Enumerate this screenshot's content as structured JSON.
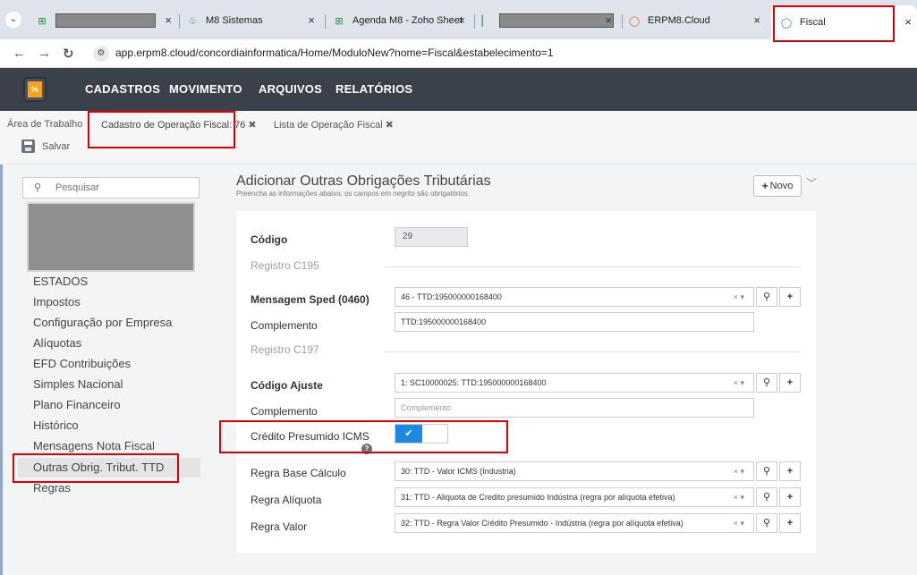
{
  "browser": {
    "tabs": [
      {
        "label": "",
        "redacted": true
      },
      {
        "label": "M8 Sistemas"
      },
      {
        "label": "Agenda M8 - Zoho Sheet"
      },
      {
        "label": "",
        "redacted": true
      },
      {
        "label": "ERPM8.Cloud"
      },
      {
        "label": "Fiscal",
        "active": true
      }
    ],
    "tab_close": "×",
    "url": "app.erpm8.cloud/concordiainformatica/Home/ModuloNew?nome=Fiscal&estabelecimento=1"
  },
  "menu": {
    "logo_text": "%",
    "items": [
      "CADASTROS",
      "MOVIMENTO",
      "ARQUIVOS",
      "RELATÓRIOS"
    ]
  },
  "breadcrumb": {
    "items": [
      "Área de Trabalho",
      "Cadastro de Operação Fiscal: 76",
      "Lista de Operação Fiscal"
    ],
    "close": "✖"
  },
  "toolbar": {
    "save_label": "Salvar"
  },
  "sidebar": {
    "search_placeholder": "Pesquisar",
    "items": [
      "ESTADOS",
      "Impostos",
      "Configuração por Empresa",
      "Alíquotas",
      "EFD Contribuições",
      "Simples Nacional",
      "Plano Financeiro",
      "Histórico",
      "Mensagens Nota Fiscal",
      "Outras Obrig. Tribut. TTD",
      "Regras"
    ]
  },
  "main": {
    "title": "Adicionar Outras Obrigações Tributárias",
    "subtitle": "Preencha as informações abaixo, os campos em negrito são obrigatórios.",
    "new_label": "Novo",
    "form": {
      "codigo_label": "Código",
      "codigo_value": "29",
      "section_c195": "Registro C195",
      "mensagem_label": "Mensagem Sped (0460)",
      "mensagem_value": "46 - TTD:195000000168400",
      "complemento1_label": "Complemento",
      "complemento1_value": "TTD:195000000168400",
      "section_c197": "Registro C197",
      "ajuste_label": "Código Ajuste",
      "ajuste_value": "1: SC10000025: TTD:195000000168400",
      "complemento2_label": "Complemento",
      "complemento2_placeholder": "Complemento",
      "credito_label": "Crédito Presumido ICMS",
      "credito_checked": true,
      "regra_base_label": "Regra Base Cálculo",
      "regra_base_value": "30: TTD - Valor ICMS (Industria)",
      "regra_aliquota_label": "Regra Alíquota",
      "regra_aliquota_value": "31: TTD - Aliquota de Credito presumido Indústria (regra por alíquota efetiva)",
      "regra_valor_label": "Regra Valor",
      "regra_valor_value": "32: TTD - Regra Valor Crédito Presumido - Indústria (regra por alíquota efetiva)"
    }
  }
}
